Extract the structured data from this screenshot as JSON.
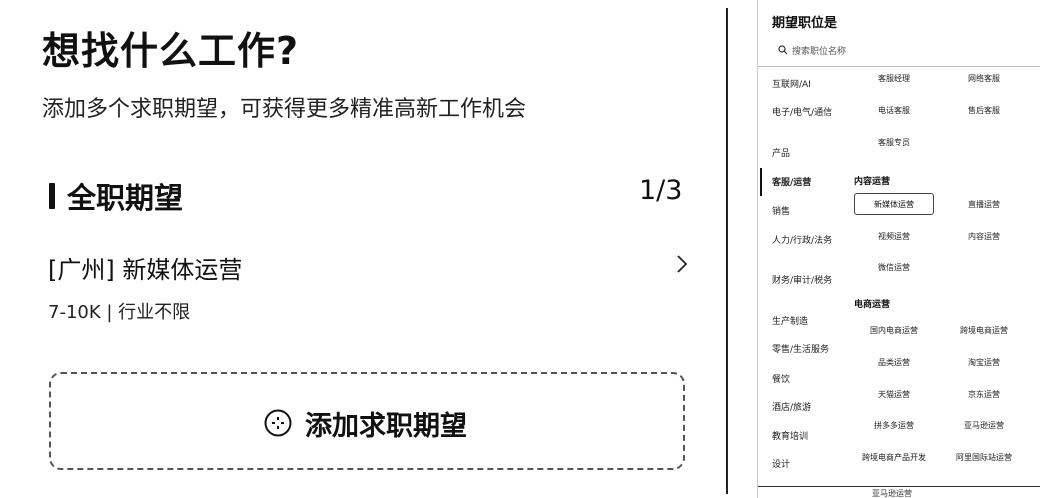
{
  "main": {
    "title": "想找什么工作?",
    "subtitle": "添加多个求职期望，可获得更多精准高新工作机会",
    "section_title": "全职期望",
    "section_count": "1/3",
    "job_title": "[广州] 新媒体运营",
    "job_meta": "7-10K | 行业不限",
    "add_label": "添加求职期望"
  },
  "panel": {
    "title": "期望职位是",
    "search_placeholder": "搜索职位名称",
    "categories": [
      {
        "label": "互联网/AI"
      },
      {
        "label": "电子/电气/通信"
      },
      {
        "label": "产品"
      },
      {
        "label": "客服/运营",
        "active": true
      },
      {
        "label": "销售"
      },
      {
        "label": "人力/行政/法务"
      },
      {
        "label": "财务/审计/税务"
      },
      {
        "label": "生产制造"
      },
      {
        "label": "零售/生活服务"
      },
      {
        "label": "餐饮"
      },
      {
        "label": "酒店/旅游"
      },
      {
        "label": "教育培训"
      },
      {
        "label": "设计"
      }
    ],
    "top_items": [
      "客服经理",
      "网络客服",
      "电话客服",
      "售后客服",
      "客服专员"
    ],
    "groups": [
      {
        "name": "内容运营",
        "selected": "新媒体运营",
        "items": [
          "直播运营",
          "视频运营",
          "内容运营",
          "微信运营"
        ]
      },
      {
        "name": "电商运营",
        "items": [
          "国内电商运营",
          "跨境电商运营",
          "品类运营",
          "淘宝运营",
          "天猫运营",
          "京东运营",
          "拼多多运营",
          "亚马逊运营",
          "跨境电商产品开发",
          "阿里国际站运营"
        ]
      }
    ],
    "cut_text": "亚马逊运营"
  }
}
